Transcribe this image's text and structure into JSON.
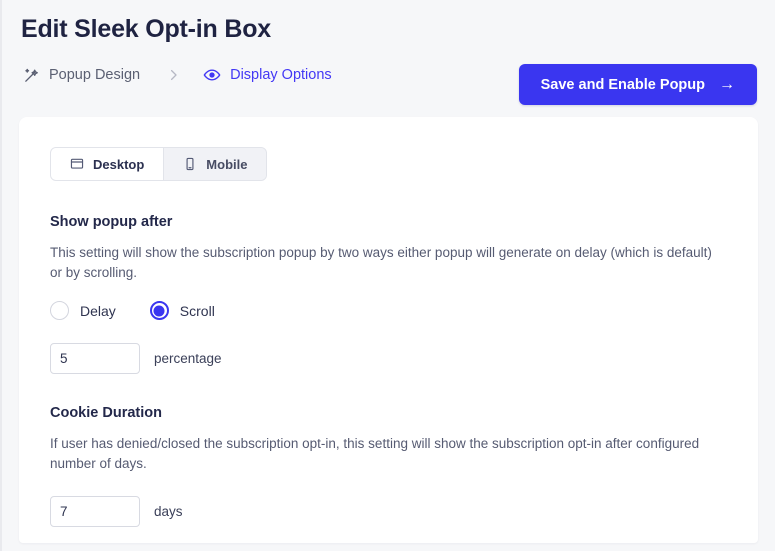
{
  "header": {
    "title": "Edit Sleek Opt-in Box",
    "breadcrumb": [
      {
        "label": "Popup Design",
        "icon": "magic-wand-icon",
        "state": "inactive"
      },
      {
        "label": "Display Options",
        "icon": "eye-icon",
        "state": "active"
      }
    ],
    "separator_icon": "chevron-right-icon",
    "save_button": {
      "label": "Save and Enable Popup",
      "arrow": "→",
      "color": "#3a36f0"
    }
  },
  "tabs": [
    {
      "label": "Desktop",
      "icon": "monitor-icon",
      "active": true
    },
    {
      "label": "Mobile",
      "icon": "phone-icon",
      "active": false
    }
  ],
  "sections": [
    {
      "title": "Show popup after",
      "description": "This setting will show the subscription popup by two ways either popup will generate on delay (which is default) or by scrolling.",
      "radios": [
        {
          "label": "Delay",
          "selected": false
        },
        {
          "label": "Scroll",
          "selected": true
        }
      ],
      "field": {
        "value": "5",
        "placeholder": "",
        "unit": "percentage"
      }
    },
    {
      "title": "Cookie Duration",
      "description": "If user has denied/closed the subscription opt-in, this setting will show the subscription opt-in after configured number of days.",
      "field": {
        "value": "7",
        "placeholder": "",
        "unit": "days"
      }
    }
  ],
  "colors": {
    "accent": "#3a36f0",
    "link": "#4338f5",
    "page_background": "#f6f7f9",
    "card_background": "#ffffff",
    "title": "#1f2342"
  }
}
